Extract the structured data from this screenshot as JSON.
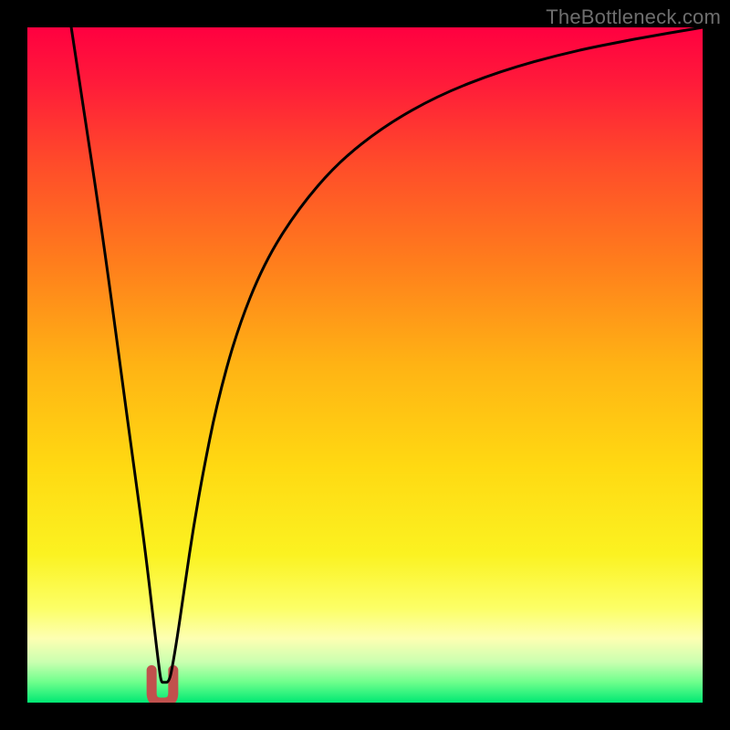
{
  "watermark": "TheBottleneck.com",
  "chart_data": {
    "type": "line",
    "title": "",
    "xlabel": "",
    "ylabel": "",
    "xlim": [
      0,
      100
    ],
    "ylim": [
      0,
      100
    ],
    "background_gradient": {
      "stops": [
        {
          "offset": 0.0,
          "color": "#ff0040"
        },
        {
          "offset": 0.08,
          "color": "#ff1a3a"
        },
        {
          "offset": 0.2,
          "color": "#ff4b2a"
        },
        {
          "offset": 0.35,
          "color": "#ff7e1c"
        },
        {
          "offset": 0.5,
          "color": "#ffb314"
        },
        {
          "offset": 0.65,
          "color": "#ffd912"
        },
        {
          "offset": 0.78,
          "color": "#fbf221"
        },
        {
          "offset": 0.86,
          "color": "#fcff66"
        },
        {
          "offset": 0.905,
          "color": "#fdffb2"
        },
        {
          "offset": 0.94,
          "color": "#caffb0"
        },
        {
          "offset": 0.97,
          "color": "#6dff8c"
        },
        {
          "offset": 1.0,
          "color": "#00e873"
        }
      ]
    },
    "series": [
      {
        "name": "bottleneck-curve",
        "stroke": "#000000",
        "x": [
          6.5,
          8,
          10,
          12,
          14,
          15.5,
          17,
          18,
          18.8,
          19.4,
          19.8,
          20.2,
          21,
          21.6,
          22.4,
          23.4,
          24.6,
          26,
          28,
          31,
          35,
          40,
          46,
          53,
          61,
          70,
          80,
          90,
          100
        ],
        "y": [
          100,
          90,
          77,
          63,
          48,
          37,
          26,
          18,
          11,
          6,
          3,
          3,
          3,
          6,
          11,
          18,
          26,
          34,
          44,
          55,
          65,
          73,
          80,
          85.5,
          90,
          93.5,
          96.3,
          98.3,
          100
        ]
      }
    ],
    "dip_marker": {
      "name": "dip-marker",
      "color": "#c1514d",
      "x_center": 20,
      "width": 3.2,
      "height": 4.8
    }
  }
}
